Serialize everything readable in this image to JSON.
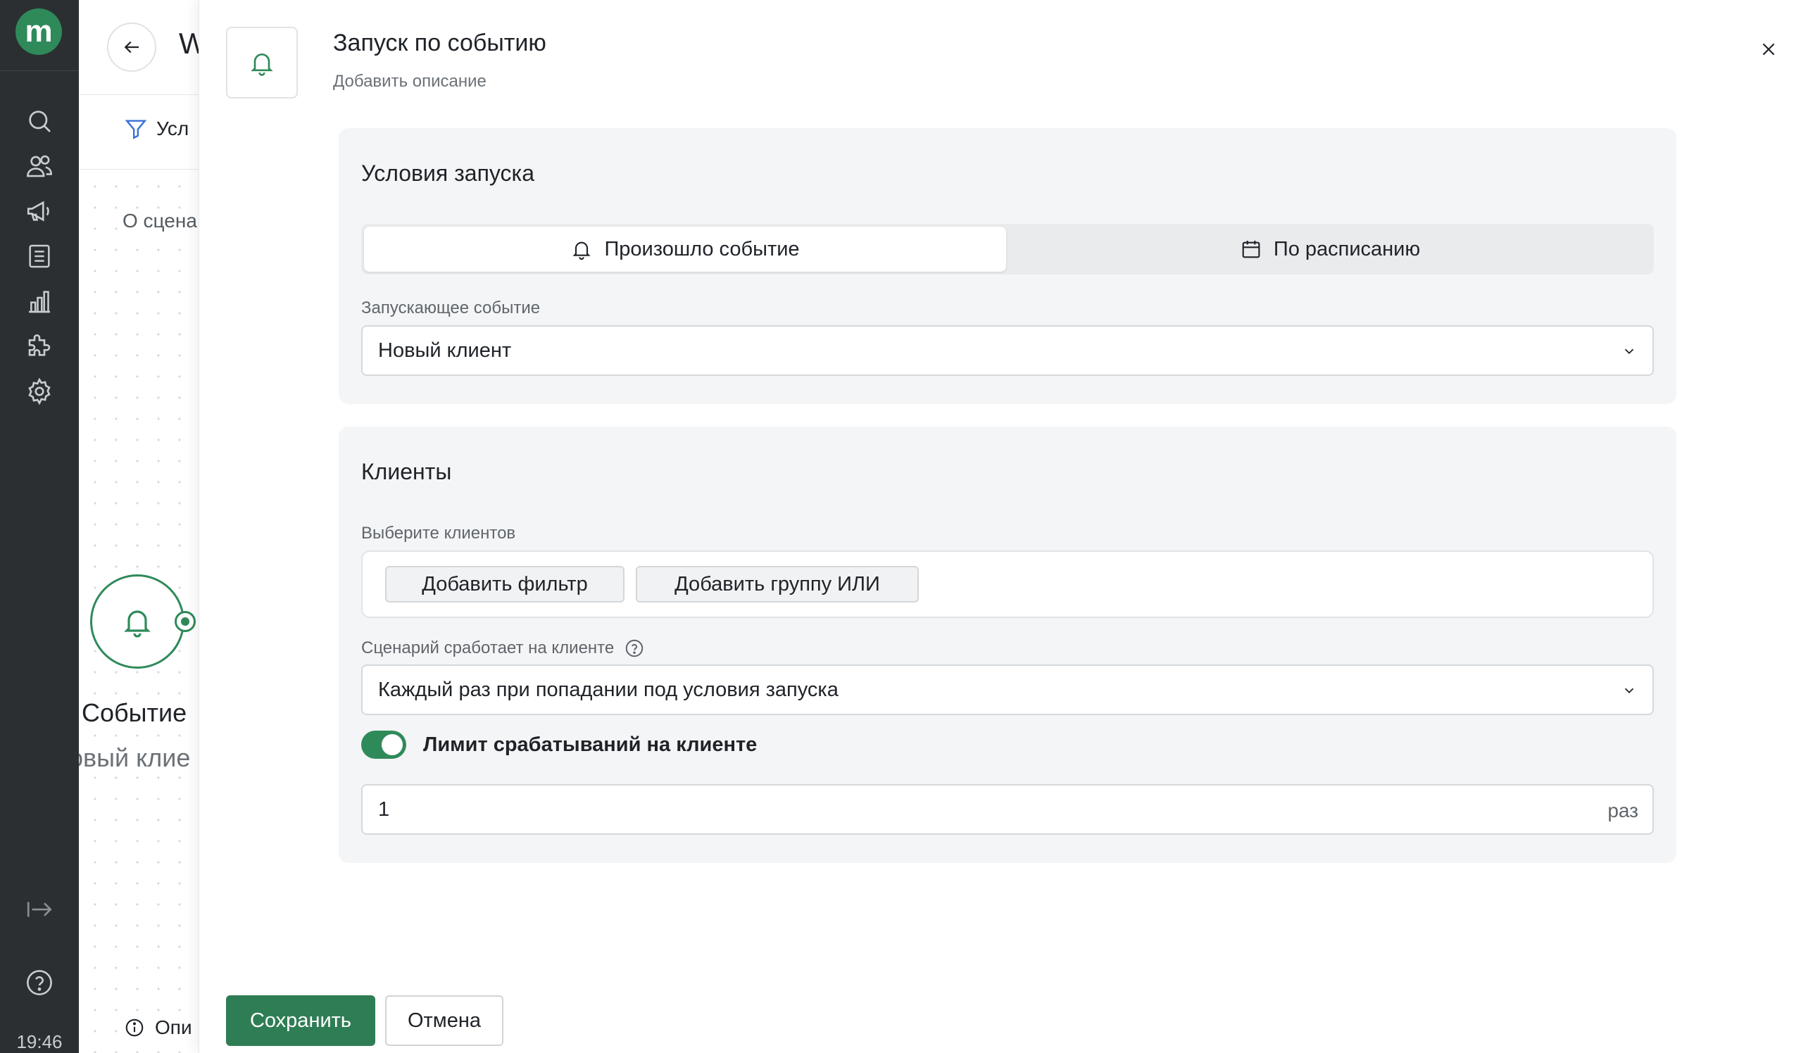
{
  "app": {
    "logo_letter": "m",
    "accent_color": "#2f8a5a",
    "time": "19:46"
  },
  "nav": {
    "items": [
      {
        "icon": "search-icon"
      },
      {
        "icon": "users-icon"
      },
      {
        "icon": "megaphone-icon"
      },
      {
        "icon": "document-icon"
      },
      {
        "icon": "chart-icon"
      },
      {
        "icon": "puzzle-icon"
      },
      {
        "icon": "gear-icon"
      }
    ],
    "bottom": [
      {
        "icon": "collapse-arrow-icon"
      },
      {
        "icon": "help-icon"
      }
    ]
  },
  "background_editor": {
    "title_peek": "W",
    "tab_peek": "Усл",
    "about_peek": "О сцена",
    "node_title": "Событие",
    "node_subtitle": "овый клие",
    "description_peek": "Опи"
  },
  "drawer": {
    "title": "Запуск по событию",
    "description_placeholder": "Добавить описание",
    "launch_conditions": {
      "title": "Условия запуска",
      "tabs": [
        {
          "label": "Произошло событие",
          "icon": "bell-icon",
          "active": true
        },
        {
          "label": "По расписанию",
          "icon": "calendar-icon",
          "active": false
        }
      ],
      "trigger_label": "Запускающее событие",
      "trigger_value": "Новый клиент"
    },
    "clients": {
      "title": "Клиенты",
      "select_label": "Выберите клиентов",
      "add_filter": "Добавить фильтр",
      "add_or_group": "Добавить группу ИЛИ",
      "runs_label": "Сценарий сработает на клиенте",
      "runs_value": "Каждый раз при попадании под условия запуска",
      "limit_toggle_label": "Лимит срабатываний на клиенте",
      "limit_toggle_on": true,
      "limit_value": "1",
      "limit_suffix": "раз"
    },
    "save_label": "Сохранить",
    "cancel_label": "Отмена"
  }
}
